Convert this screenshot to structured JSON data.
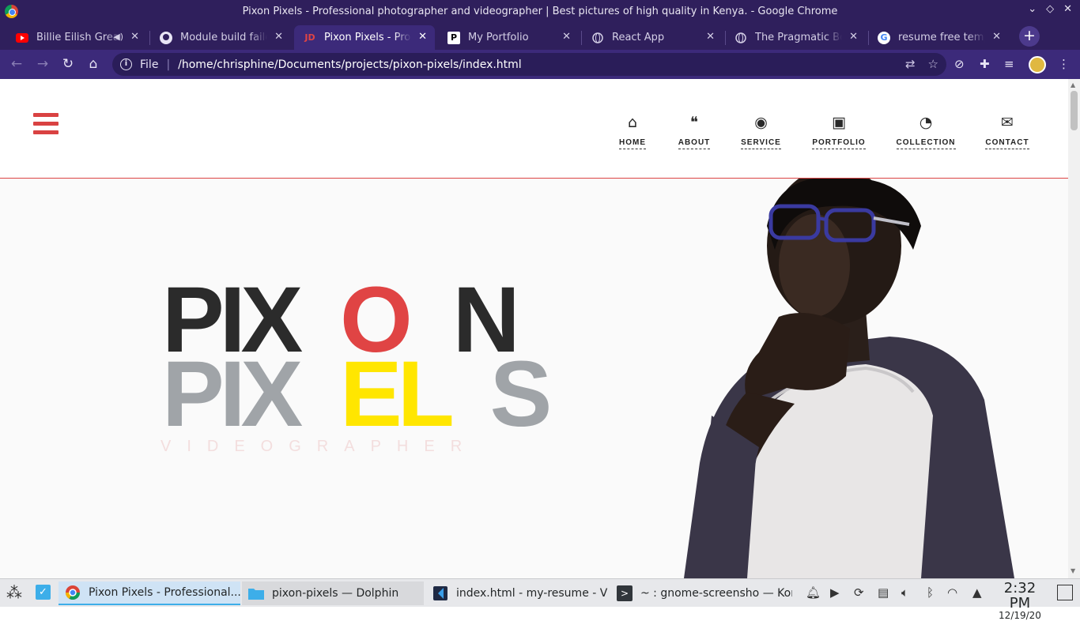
{
  "window": {
    "title": "Pixon Pixels - Professional photographer and videographer | Best pictures of high quality in Kenya. - Google Chrome"
  },
  "tabs": [
    {
      "title": "Billie Eilish Great",
      "icon": "youtube-icon",
      "audio": true
    },
    {
      "title": "Module build failed",
      "icon": "github-icon"
    },
    {
      "title": "Pixon Pixels - Professional",
      "icon": "jd-icon",
      "active": true
    },
    {
      "title": "My Portfolio",
      "icon": "p-icon"
    },
    {
      "title": "React App",
      "icon": "globe-icon"
    },
    {
      "title": "The Pragmatic Bookshelf",
      "icon": "globe-icon"
    },
    {
      "title": "resume free template",
      "icon": "google-icon"
    }
  ],
  "toolbar": {
    "scheme_label": "File",
    "url": "/home/chrisphine/Documents/projects/pixon-pixels/index.html"
  },
  "site": {
    "nav": [
      {
        "label": "HOME",
        "icon": "home-icon",
        "glyph": "⌂"
      },
      {
        "label": "ABOUT",
        "icon": "quote-icon",
        "glyph": "❝"
      },
      {
        "label": "SERVICE",
        "icon": "globe-icon",
        "glyph": "◉"
      },
      {
        "label": "PORTFOLIO",
        "icon": "image-icon",
        "glyph": "▣"
      },
      {
        "label": "COLLECTION",
        "icon": "rss-icon",
        "glyph": "◔"
      },
      {
        "label": "CONTACT",
        "icon": "envelope-icon",
        "glyph": "✉"
      }
    ],
    "hero": {
      "line1": [
        {
          "text": "PIX",
          "color": "#2b2b2b"
        },
        {
          "text": "O",
          "color": "#e04444"
        },
        {
          "text": "N",
          "color": "#2b2b2b"
        }
      ],
      "line2": [
        {
          "text": "PIX",
          "color": "#a0a4a8"
        },
        {
          "text": "EL",
          "color": "#ffe600"
        },
        {
          "text": "S",
          "color": "#a0a4a8"
        }
      ],
      "subtitle": "VIDEOGRAPHER"
    },
    "accent_color": "#d94242"
  },
  "taskbar": {
    "items": [
      {
        "label": "Pixon Pixels - Professional...",
        "icon": "chrome-icon",
        "active": true
      },
      {
        "label": "pixon-pixels — Dolphin",
        "icon": "folder-icon"
      },
      {
        "label": "index.html - my-resume - Visu...",
        "icon": "vscode-icon"
      },
      {
        "label": "~ : gnome-screensho — Kons...",
        "icon": "terminal-icon"
      }
    ],
    "time": "2:32 PM",
    "date": "12/19/20"
  }
}
